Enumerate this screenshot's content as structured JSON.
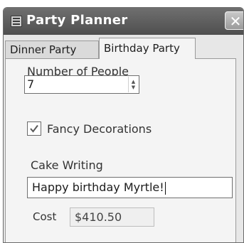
{
  "window": {
    "title": "Party Planner",
    "close_glyph": "✕",
    "icon": "app-window-icon"
  },
  "tabs": [
    {
      "label": "Dinner Party",
      "selected": false
    },
    {
      "label": "Birthday Party",
      "selected": true
    }
  ],
  "form": {
    "number_of_people_label": "Number of People",
    "number_of_people_value": "7",
    "fancy_decorations_label": "Fancy Decorations",
    "fancy_decorations_checked": true,
    "cake_writing_label": "Cake Writing",
    "cake_writing_value": "Happy birthday Myrtle!",
    "cost_label": "Cost",
    "cost_value": "$410.50"
  },
  "colors": {
    "titlebar": "#5e5e5e",
    "window_bg": "#e7e7e7",
    "panel_bg": "#f4f4f4"
  }
}
